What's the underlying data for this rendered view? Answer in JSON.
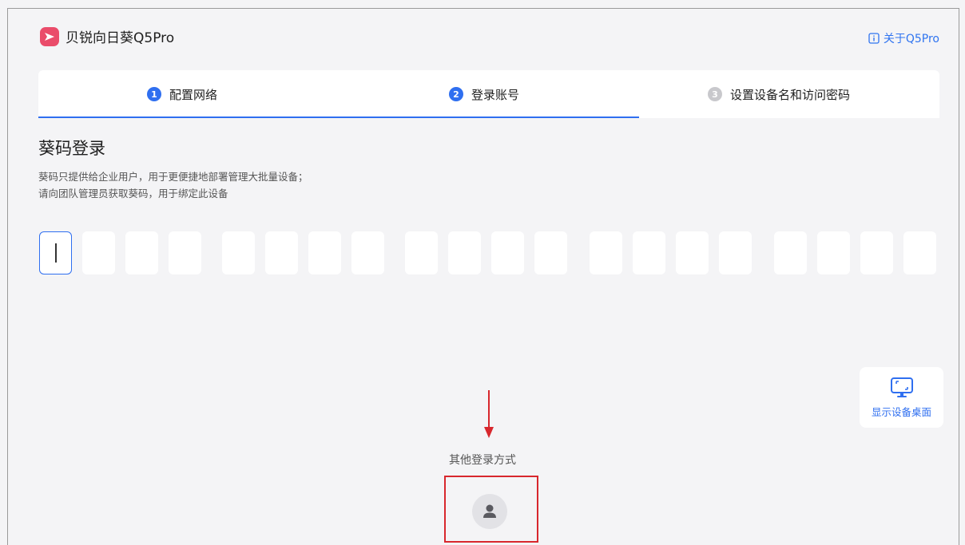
{
  "app": {
    "title": "贝锐向日葵Q5Pro",
    "about_label": "关于Q5Pro"
  },
  "steps": [
    {
      "num": "1",
      "label": "配置网络",
      "state": "done"
    },
    {
      "num": "2",
      "label": "登录账号",
      "state": "active"
    },
    {
      "num": "3",
      "label": "设置设备名和访问密码",
      "state": "inactive"
    }
  ],
  "login": {
    "title": "葵码登录",
    "desc_line1": "葵码只提供给企业用户，用于更便捷地部署管理大批量设备；",
    "desc_line2": "请向团队管理员获取葵码，用于绑定此设备",
    "code_value": "",
    "code_box_count": 20
  },
  "show_desktop": {
    "label": "显示设备桌面",
    "icon": "monitor-icon"
  },
  "other_login": {
    "label": "其他登录方式",
    "icon": "user-icon"
  },
  "colors": {
    "accent": "#2f6ff0",
    "brand": "#ea4c6a",
    "annotation": "#d8272d"
  }
}
